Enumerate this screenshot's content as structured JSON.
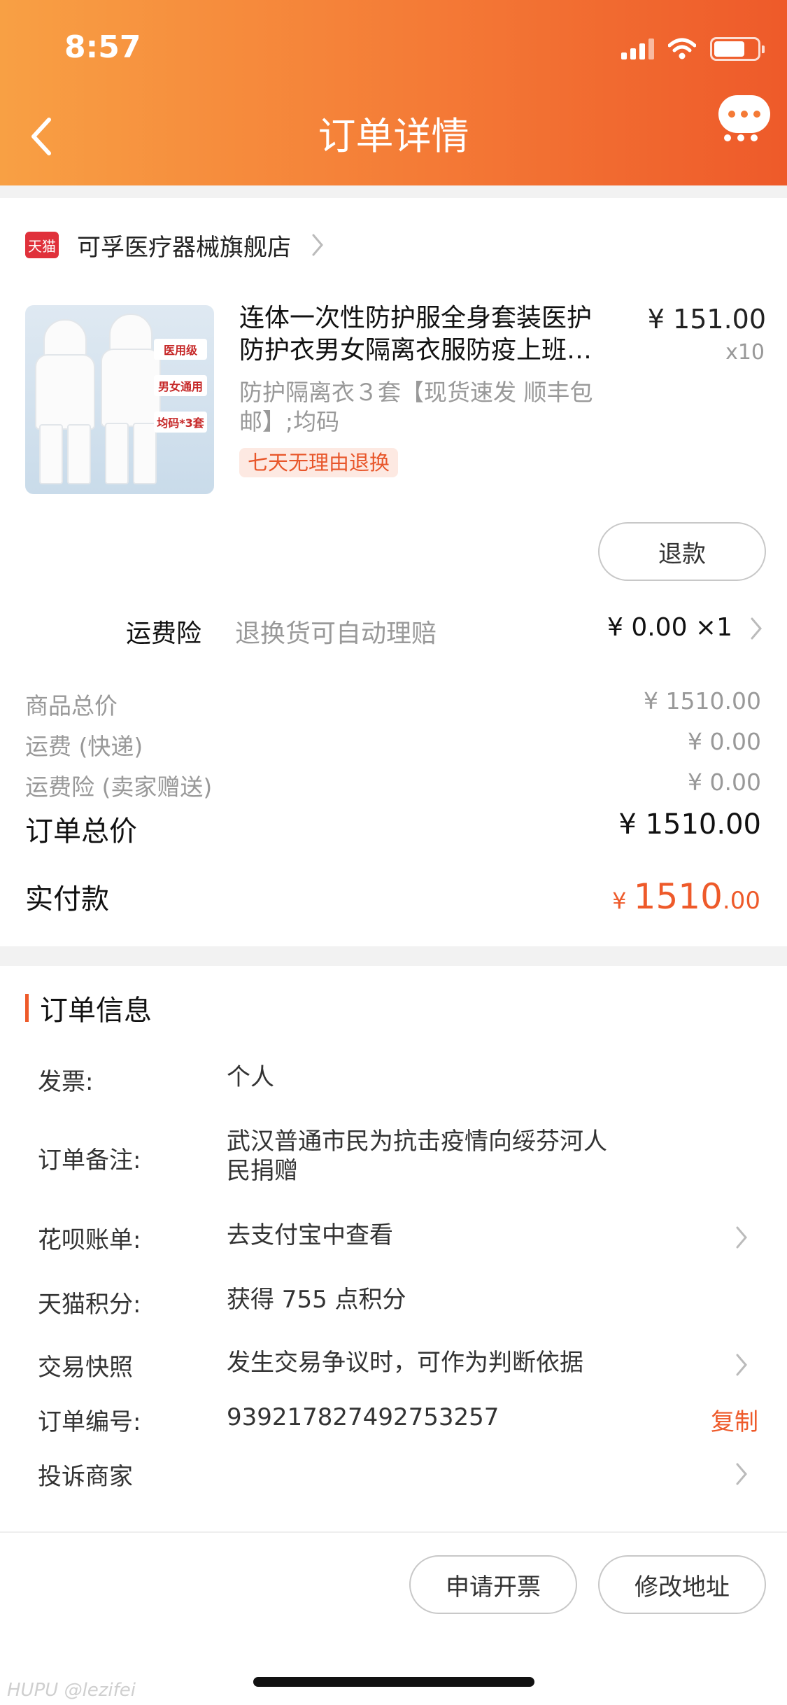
{
  "status_bar": {
    "time": "8:57"
  },
  "header": {
    "title": "订单详情"
  },
  "store": {
    "badge": "天猫",
    "name": "可孚医疗器械旗舰店"
  },
  "product": {
    "title_line1": "连体一次性防护服全身套装医护",
    "title_line2": "防护衣男女隔离衣服防疫上班…",
    "price": "¥ 151.00",
    "quantity": "x10",
    "sku_line1": "防护隔离衣３套【现货速发 顺丰包",
    "sku_line2": "邮】;均码",
    "return_badge": "七天无理由退换",
    "image_tags": [
      "医用级",
      "男女通用",
      "均码*3套"
    ],
    "refund_button": "退款"
  },
  "shipping_insurance": {
    "label": "运费险",
    "desc": "退换货可自动理赔",
    "value": "¥ 0.00 ×1"
  },
  "fees": [
    {
      "label": "商品总价",
      "value": "¥ 1510.00"
    },
    {
      "label": "运费 (快递)",
      "value": "¥ 0.00"
    },
    {
      "label": "运费险 (卖家赠送)",
      "value": "¥ 0.00"
    }
  ],
  "order_total": {
    "label": "订单总价",
    "value": "¥ 1510.00"
  },
  "paid": {
    "label": "实付款",
    "currency": "¥ ",
    "integer": "1510",
    "decimal": ".00"
  },
  "order_info": {
    "title": "订单信息",
    "invoice": {
      "label": "发票:",
      "value": "个人"
    },
    "remark": {
      "label": "订单备注:",
      "value_line1": "武汉普通市民为抗击疫情向绥芬河人",
      "value_line2": "民捐赠"
    },
    "huabei": {
      "label": "花呗账单:",
      "value": "去支付宝中查看"
    },
    "points": {
      "label": "天猫积分:",
      "value": "获得 755 点积分"
    },
    "snapshot": {
      "label": "交易快照",
      "value": "发生交易争议时，可作为判断依据"
    },
    "order_no": {
      "label": "订单编号:",
      "value": "939217827492753257",
      "copy": "复制"
    },
    "complaint": {
      "label": "投诉商家"
    }
  },
  "actions": {
    "invoice_button": "申请开票",
    "address_button": "修改地址"
  },
  "watermark": {
    "brand": "HUPU",
    "user": "@lezifei"
  },
  "colors": {
    "accent": "#ee5a2a",
    "header_start": "#f8a044",
    "header_end": "#ee5a2a",
    "tmall_red": "#e0313b"
  }
}
